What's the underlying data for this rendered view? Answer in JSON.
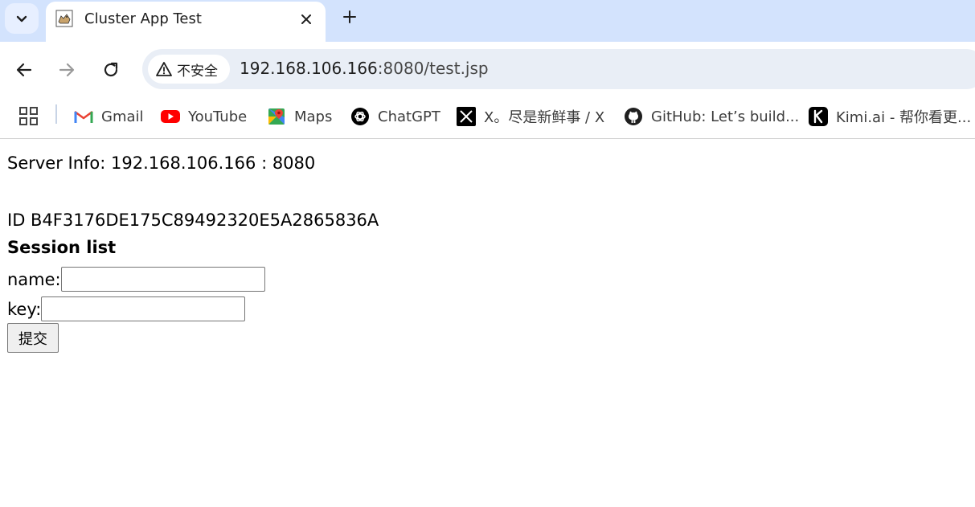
{
  "browser": {
    "tab": {
      "title": "Cluster App Test"
    },
    "omnibox": {
      "security_label": "不安全",
      "url_host": "192.168.106.166",
      "url_rest": ":8080/test.jsp"
    },
    "bookmarks": [
      {
        "label": "Gmail",
        "icon": "gmail-icon"
      },
      {
        "label": "YouTube",
        "icon": "youtube-icon"
      },
      {
        "label": "Maps",
        "icon": "maps-icon"
      },
      {
        "label": "ChatGPT",
        "icon": "chatgpt-icon"
      },
      {
        "label": "X。尽是新鲜事 / X",
        "icon": "x-icon"
      },
      {
        "label": "GitHub: Let’s build...",
        "icon": "github-icon"
      },
      {
        "label": "Kimi.ai - 帮你看更...",
        "icon": "kimi-icon"
      }
    ]
  },
  "page": {
    "server_info": "Server Info: 192.168.106.166 : 8080",
    "session_id": "ID B4F3176DE175C89492320E5A2865836A",
    "session_list_title": "Session list",
    "name_label": "name:",
    "name_value": "",
    "key_label": "key:",
    "key_value": "",
    "submit_label": "提交"
  },
  "colors": {
    "tabstrip_bg": "#d3e3fd",
    "omnibox_bg": "#e9eef6",
    "youtube_red": "#ff0000",
    "gmail_red": "#ea4335"
  }
}
